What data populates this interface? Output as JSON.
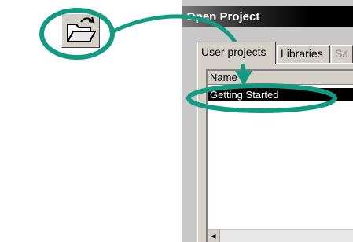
{
  "toolbar": {
    "open_icon": "open-folder-icon"
  },
  "dialog": {
    "title": "Open Project",
    "tabs": [
      {
        "label": "User projects",
        "state": "active"
      },
      {
        "label": "Libraries",
        "state": "normal"
      },
      {
        "label": "Sa",
        "state": "disabled"
      }
    ],
    "list": {
      "column_header": "Name",
      "rows": [
        "Getting Started"
      ],
      "selected_row": "Getting Started"
    }
  },
  "annotation": {
    "color": "#129a82",
    "arrow_icon": "arrow-icon"
  }
}
